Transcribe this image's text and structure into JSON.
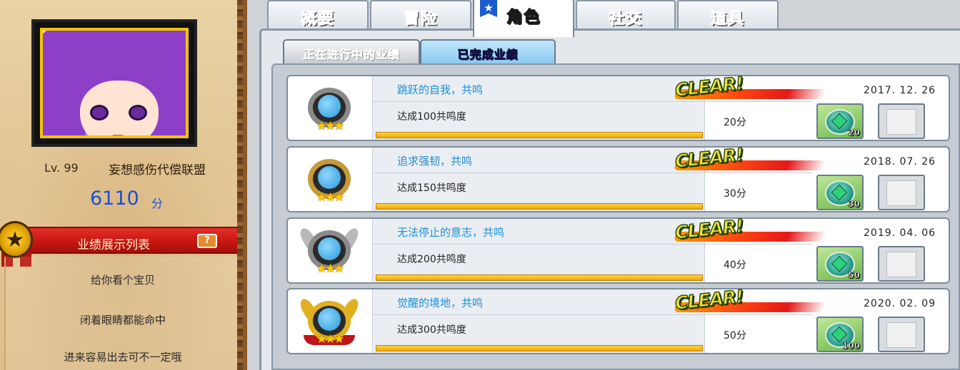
{
  "tabs": [
    {
      "label": "概要"
    },
    {
      "label": "冒险"
    },
    {
      "label": "角色"
    },
    {
      "label": "社交"
    },
    {
      "label": "道具"
    }
  ],
  "subtabs": {
    "in_progress": "正在进行中的业绩",
    "completed": "已完成业绩"
  },
  "profile": {
    "level": "Lv. 99",
    "title": "妄想感伤代偿联盟",
    "points": "6110",
    "points_unit": "分"
  },
  "showcase": {
    "banner_label": "业绩展示列表",
    "help_label": "?",
    "medal_icon": "★",
    "items": [
      {
        "label": "给你看个宝贝"
      },
      {
        "label": "闭着眼睛都能命中"
      },
      {
        "label": "进来容易出去可不一定哦"
      }
    ]
  },
  "achievements": [
    {
      "title": "跳跃的自我，共鸣",
      "desc": "达成100共鸣度",
      "score": "20分",
      "date": "2017. 12. 26",
      "reward_count": "20",
      "clear": "CLEAR!",
      "progress": 1.0
    },
    {
      "title": "追求强韧，共鸣",
      "desc": "达成150共鸣度",
      "score": "30分",
      "date": "2018. 07. 26",
      "reward_count": "30",
      "clear": "CLEAR!",
      "progress": 1.0
    },
    {
      "title": "无法停止的意志，共鸣",
      "desc": "达成200共鸣度",
      "score": "40分",
      "date": "2019. 04. 06",
      "reward_count": "50",
      "clear": "CLEAR!",
      "progress": 1.0
    },
    {
      "title": "觉醒的境地，共鸣",
      "desc": "达成300共鸣度",
      "score": "50分",
      "date": "2020. 02. 09",
      "reward_count": "100",
      "clear": "CLEAR!",
      "progress": 1.0
    }
  ],
  "medal_stars": "★★★",
  "colors": {
    "accent_blue": "#1b8fd8",
    "points_blue": "#1b4fd6",
    "banner_red": "#c71710",
    "progress_gold": "#f0a800"
  }
}
